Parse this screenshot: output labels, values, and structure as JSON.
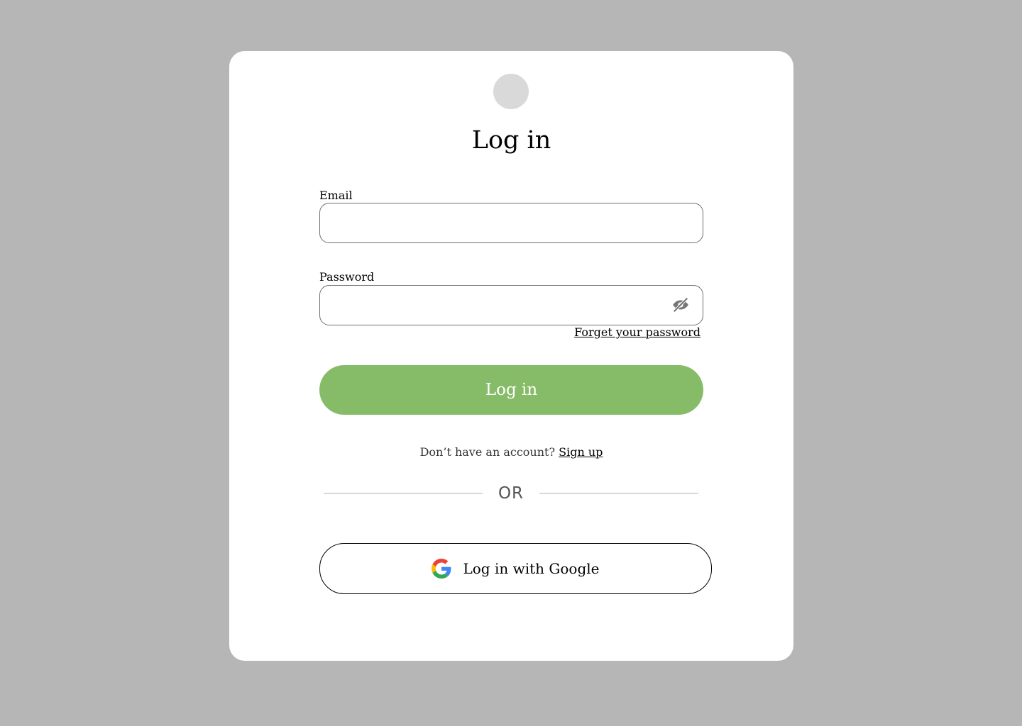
{
  "header": {
    "title": "Log in"
  },
  "form": {
    "email": {
      "label": "Email",
      "value": "",
      "placeholder": ""
    },
    "password": {
      "label": "Password",
      "value": "",
      "placeholder": "",
      "visibility_icon": "eye-off-icon"
    },
    "forgot_password_label": "Forget your password",
    "submit_label": "Log in"
  },
  "signup": {
    "prompt": "Don’t have an account?",
    "link_label": "Sign up"
  },
  "divider": {
    "label": "OR"
  },
  "google": {
    "label": "Log in with Google",
    "icon": "google-icon"
  },
  "colors": {
    "background": "#b6b6b6",
    "card": "#ffffff",
    "primary_button": "#86bc68",
    "logo_placeholder": "#d9d9d9"
  }
}
